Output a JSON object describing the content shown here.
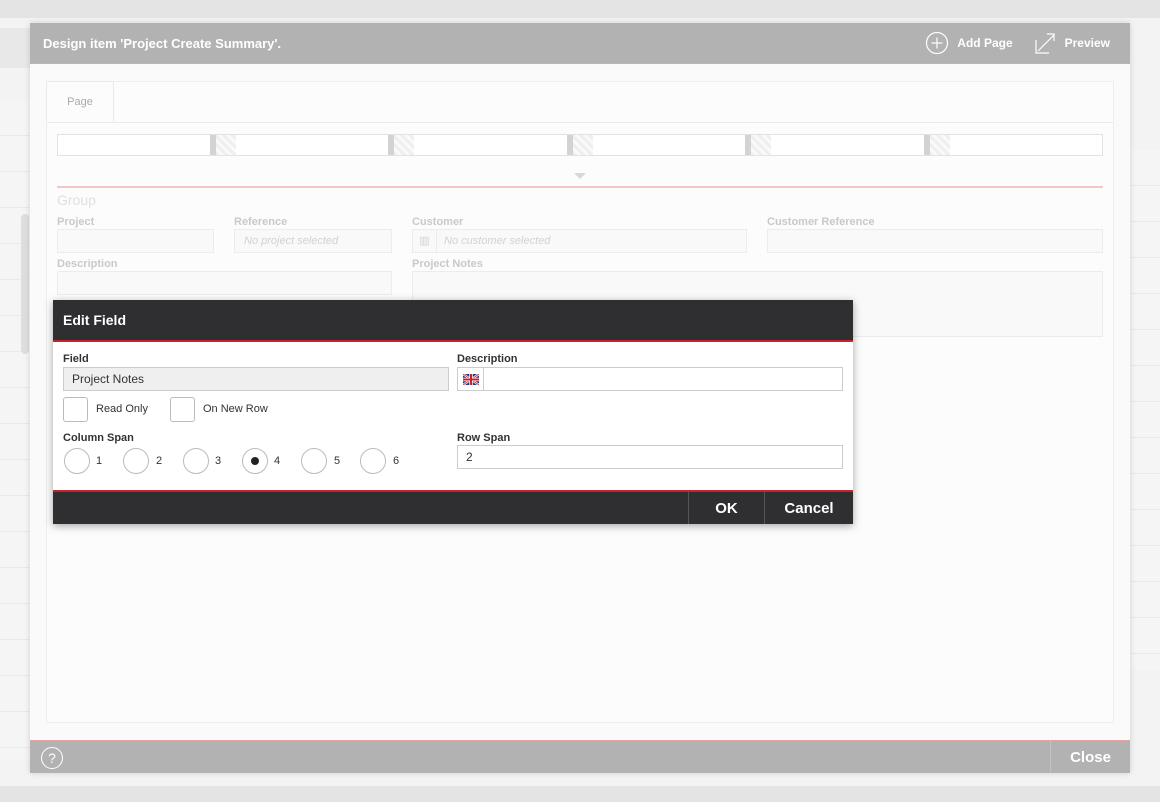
{
  "design": {
    "title": "Design item 'Project Create Summary'.",
    "add_page": "Add Page",
    "preview": "Preview",
    "tab": "Page",
    "group_title": "Group",
    "fields": {
      "project": "Project",
      "reference": "Reference",
      "reference_placeholder": "No project selected",
      "customer": "Customer",
      "customer_placeholder": "No customer selected",
      "customer_reference": "Customer Reference",
      "description": "Description",
      "project_notes": "Project Notes"
    },
    "close": "Close",
    "help": "?"
  },
  "edit_field": {
    "title": "Edit Field",
    "field_label": "Field",
    "field_value": "Project Notes",
    "description_label": "Description",
    "description_value": "",
    "read_only": "Read Only",
    "on_new_row": "On New Row",
    "column_span_label": "Column Span",
    "column_span_options": [
      "1",
      "2",
      "3",
      "4",
      "5",
      "6"
    ],
    "column_span_selected": "4",
    "row_span_label": "Row Span",
    "row_span_value": "2",
    "ok": "OK",
    "cancel": "Cancel"
  },
  "colors": {
    "header_grey": "#b2b2b2",
    "dialog_dark": "#2f2f31",
    "accent_red": "#c8222a"
  }
}
